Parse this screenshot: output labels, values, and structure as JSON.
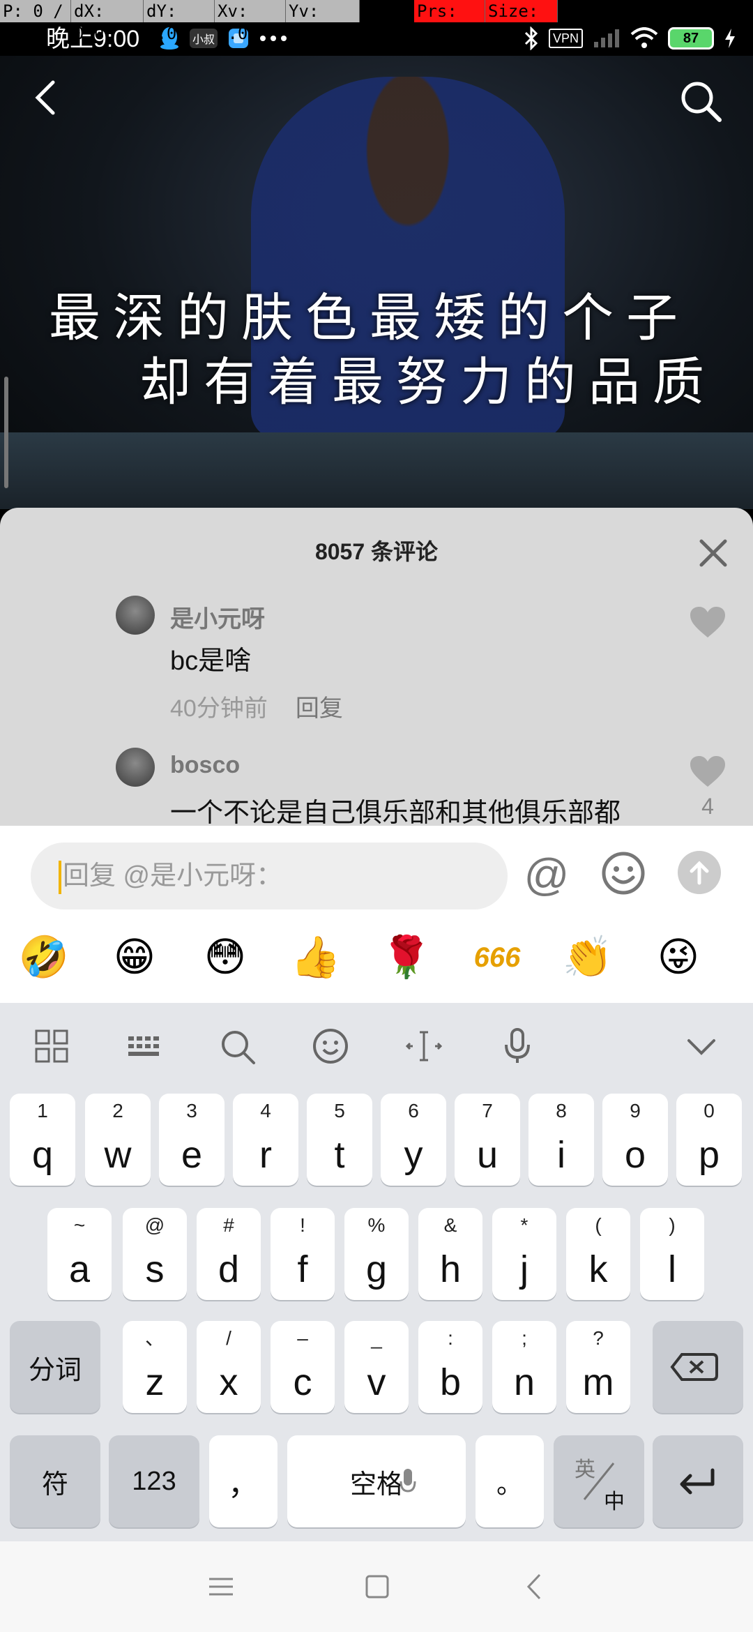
{
  "debug": {
    "pointer": "P: 0 / 1",
    "dx": "dX: 0.0",
    "dy": "dY: 0.0",
    "xv": "Xv: 0.0",
    "yv": "Yv: 0.0",
    "prs": "Prs: 1.0",
    "size": "Size: 1.0"
  },
  "status_bar": {
    "time": "晚上9:00",
    "app_badge_1": "小叔",
    "vpn": "VPN",
    "battery": "87"
  },
  "video": {
    "caption_line1": "最深的肤色最矮的个子",
    "caption_line2": "却有着最努力的品质"
  },
  "comments": {
    "title": "8057 条评论",
    "items": [
      {
        "user": "是小元呀",
        "text": "bc是啥",
        "time": "40分钟前",
        "reply_label": "回复",
        "likes": ""
      },
      {
        "user": "bosco",
        "text": "一个不论是自己俱乐部和其他俱乐部都",
        "likes": "4"
      }
    ]
  },
  "reply": {
    "placeholder": "回复 @是小元呀：",
    "at_symbol": "@",
    "emojis": [
      "🤣",
      "😁",
      "😳",
      "👍",
      "🌹",
      "666",
      "👏",
      "😜"
    ]
  },
  "keyboard": {
    "row1": [
      {
        "sub": "1",
        "main": "q"
      },
      {
        "sub": "2",
        "main": "w"
      },
      {
        "sub": "3",
        "main": "e"
      },
      {
        "sub": "4",
        "main": "r"
      },
      {
        "sub": "5",
        "main": "t"
      },
      {
        "sub": "6",
        "main": "y"
      },
      {
        "sub": "7",
        "main": "u"
      },
      {
        "sub": "8",
        "main": "i"
      },
      {
        "sub": "9",
        "main": "o"
      },
      {
        "sub": "0",
        "main": "p"
      }
    ],
    "row2": [
      {
        "sub": "~",
        "main": "a"
      },
      {
        "sub": "@",
        "main": "s"
      },
      {
        "sub": "#",
        "main": "d"
      },
      {
        "sub": "!",
        "main": "f"
      },
      {
        "sub": "%",
        "main": "g"
      },
      {
        "sub": "&",
        "main": "h"
      },
      {
        "sub": "*",
        "main": "j"
      },
      {
        "sub": "(",
        "main": "k"
      },
      {
        "sub": ")",
        "main": "l"
      }
    ],
    "row3": [
      {
        "sub": "、",
        "main": "z"
      },
      {
        "sub": "/",
        "main": "x"
      },
      {
        "sub": "–",
        "main": "c"
      },
      {
        "sub": "_",
        "main": "v"
      },
      {
        "sub": ":",
        "main": "b"
      },
      {
        "sub": ";",
        "main": "n"
      },
      {
        "sub": "?",
        "main": "m"
      }
    ],
    "segment_key": "分词",
    "symbol_key": "符",
    "num_key": "123",
    "comma_key": "，",
    "space_key": "空格",
    "period_key": "。",
    "lang_top": "英",
    "lang_bottom": "中"
  }
}
